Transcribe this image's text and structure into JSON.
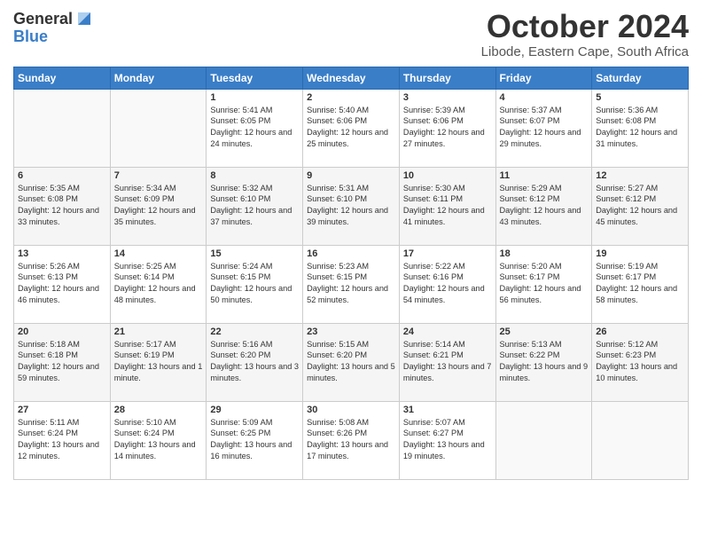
{
  "logo": {
    "general": "General",
    "blue": "Blue"
  },
  "title": "October 2024",
  "location": "Libode, Eastern Cape, South Africa",
  "days_of_week": [
    "Sunday",
    "Monday",
    "Tuesday",
    "Wednesday",
    "Thursday",
    "Friday",
    "Saturday"
  ],
  "weeks": [
    [
      {
        "day": "",
        "detail": ""
      },
      {
        "day": "",
        "detail": ""
      },
      {
        "day": "1",
        "detail": "Sunrise: 5:41 AM\nSunset: 6:05 PM\nDaylight: 12 hours and 24 minutes."
      },
      {
        "day": "2",
        "detail": "Sunrise: 5:40 AM\nSunset: 6:06 PM\nDaylight: 12 hours and 25 minutes."
      },
      {
        "day": "3",
        "detail": "Sunrise: 5:39 AM\nSunset: 6:06 PM\nDaylight: 12 hours and 27 minutes."
      },
      {
        "day": "4",
        "detail": "Sunrise: 5:37 AM\nSunset: 6:07 PM\nDaylight: 12 hours and 29 minutes."
      },
      {
        "day": "5",
        "detail": "Sunrise: 5:36 AM\nSunset: 6:08 PM\nDaylight: 12 hours and 31 minutes."
      }
    ],
    [
      {
        "day": "6",
        "detail": "Sunrise: 5:35 AM\nSunset: 6:08 PM\nDaylight: 12 hours and 33 minutes."
      },
      {
        "day": "7",
        "detail": "Sunrise: 5:34 AM\nSunset: 6:09 PM\nDaylight: 12 hours and 35 minutes."
      },
      {
        "day": "8",
        "detail": "Sunrise: 5:32 AM\nSunset: 6:10 PM\nDaylight: 12 hours and 37 minutes."
      },
      {
        "day": "9",
        "detail": "Sunrise: 5:31 AM\nSunset: 6:10 PM\nDaylight: 12 hours and 39 minutes."
      },
      {
        "day": "10",
        "detail": "Sunrise: 5:30 AM\nSunset: 6:11 PM\nDaylight: 12 hours and 41 minutes."
      },
      {
        "day": "11",
        "detail": "Sunrise: 5:29 AM\nSunset: 6:12 PM\nDaylight: 12 hours and 43 minutes."
      },
      {
        "day": "12",
        "detail": "Sunrise: 5:27 AM\nSunset: 6:12 PM\nDaylight: 12 hours and 45 minutes."
      }
    ],
    [
      {
        "day": "13",
        "detail": "Sunrise: 5:26 AM\nSunset: 6:13 PM\nDaylight: 12 hours and 46 minutes."
      },
      {
        "day": "14",
        "detail": "Sunrise: 5:25 AM\nSunset: 6:14 PM\nDaylight: 12 hours and 48 minutes."
      },
      {
        "day": "15",
        "detail": "Sunrise: 5:24 AM\nSunset: 6:15 PM\nDaylight: 12 hours and 50 minutes."
      },
      {
        "day": "16",
        "detail": "Sunrise: 5:23 AM\nSunset: 6:15 PM\nDaylight: 12 hours and 52 minutes."
      },
      {
        "day": "17",
        "detail": "Sunrise: 5:22 AM\nSunset: 6:16 PM\nDaylight: 12 hours and 54 minutes."
      },
      {
        "day": "18",
        "detail": "Sunrise: 5:20 AM\nSunset: 6:17 PM\nDaylight: 12 hours and 56 minutes."
      },
      {
        "day": "19",
        "detail": "Sunrise: 5:19 AM\nSunset: 6:17 PM\nDaylight: 12 hours and 58 minutes."
      }
    ],
    [
      {
        "day": "20",
        "detail": "Sunrise: 5:18 AM\nSunset: 6:18 PM\nDaylight: 12 hours and 59 minutes."
      },
      {
        "day": "21",
        "detail": "Sunrise: 5:17 AM\nSunset: 6:19 PM\nDaylight: 13 hours and 1 minute."
      },
      {
        "day": "22",
        "detail": "Sunrise: 5:16 AM\nSunset: 6:20 PM\nDaylight: 13 hours and 3 minutes."
      },
      {
        "day": "23",
        "detail": "Sunrise: 5:15 AM\nSunset: 6:20 PM\nDaylight: 13 hours and 5 minutes."
      },
      {
        "day": "24",
        "detail": "Sunrise: 5:14 AM\nSunset: 6:21 PM\nDaylight: 13 hours and 7 minutes."
      },
      {
        "day": "25",
        "detail": "Sunrise: 5:13 AM\nSunset: 6:22 PM\nDaylight: 13 hours and 9 minutes."
      },
      {
        "day": "26",
        "detail": "Sunrise: 5:12 AM\nSunset: 6:23 PM\nDaylight: 13 hours and 10 minutes."
      }
    ],
    [
      {
        "day": "27",
        "detail": "Sunrise: 5:11 AM\nSunset: 6:24 PM\nDaylight: 13 hours and 12 minutes."
      },
      {
        "day": "28",
        "detail": "Sunrise: 5:10 AM\nSunset: 6:24 PM\nDaylight: 13 hours and 14 minutes."
      },
      {
        "day": "29",
        "detail": "Sunrise: 5:09 AM\nSunset: 6:25 PM\nDaylight: 13 hours and 16 minutes."
      },
      {
        "day": "30",
        "detail": "Sunrise: 5:08 AM\nSunset: 6:26 PM\nDaylight: 13 hours and 17 minutes."
      },
      {
        "day": "31",
        "detail": "Sunrise: 5:07 AM\nSunset: 6:27 PM\nDaylight: 13 hours and 19 minutes."
      },
      {
        "day": "",
        "detail": ""
      },
      {
        "day": "",
        "detail": ""
      }
    ]
  ]
}
